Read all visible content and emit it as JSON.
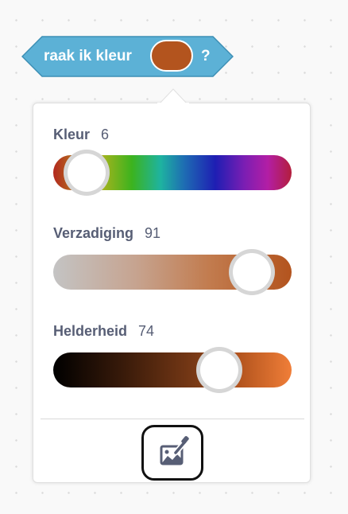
{
  "block": {
    "label": "raak ik kleur",
    "question_mark": "?",
    "swatch_color": "#b3541e",
    "block_color": "#5cb1d6"
  },
  "color_picker": {
    "hue": {
      "label": "Kleur",
      "value": "6"
    },
    "saturation": {
      "label": "Verzadiging",
      "value": "91"
    },
    "brightness": {
      "label": "Helderheid",
      "value": "74"
    },
    "eyedropper_icon": "eyedropper-icon"
  }
}
